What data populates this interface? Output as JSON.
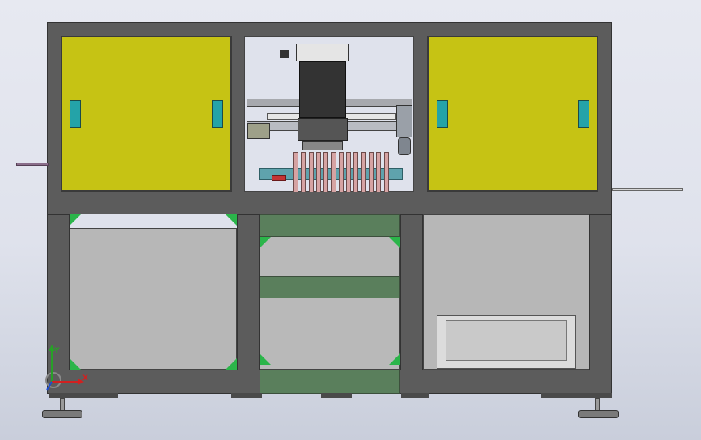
{
  "viewport": {
    "background": "#e2e4ed"
  },
  "triad": {
    "x_label": "X",
    "y_label": "Y",
    "y_color": "#28a028",
    "x_color": "#d22020",
    "z_color": "#1a4bd6"
  },
  "colors": {
    "frame": "#5c5c5c",
    "door": "#c6c314",
    "door_handle": "#24a3a8",
    "green_panel": "#5a7f5c",
    "gusset": "#2bb54a",
    "fins": "#d6a3a3",
    "panel": "#b7b7b7"
  }
}
